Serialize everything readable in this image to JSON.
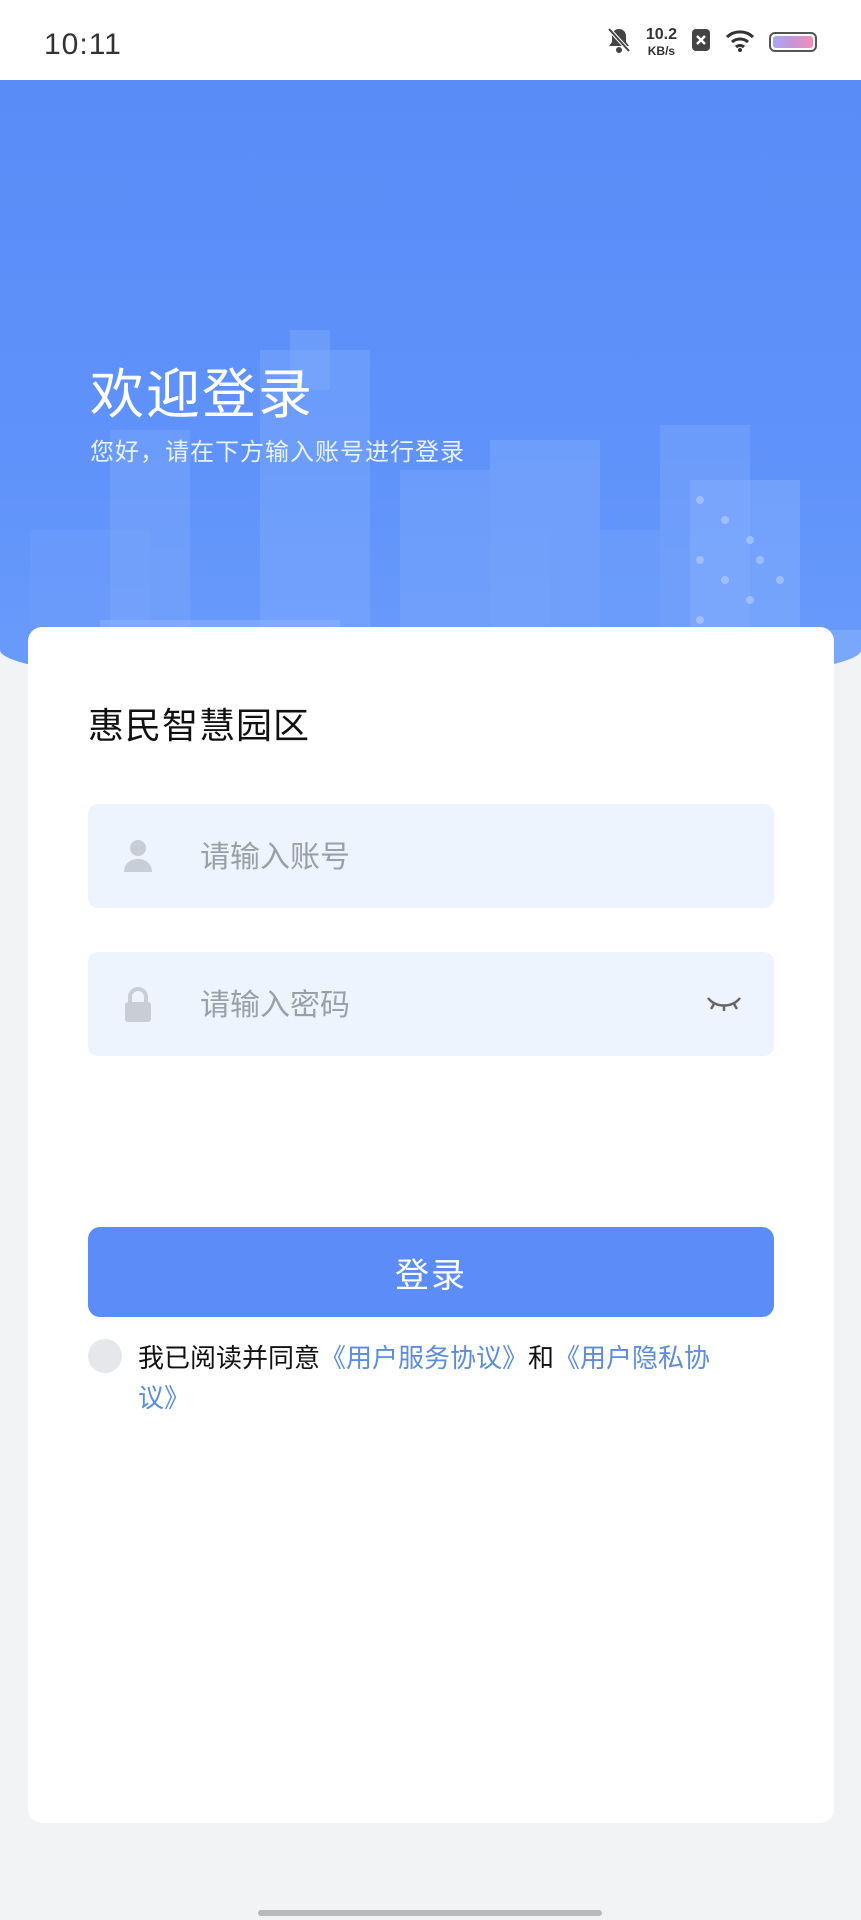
{
  "status_bar": {
    "time": "10:11",
    "net_speed_value": "10.2",
    "net_speed_unit": "KB/s",
    "icons": [
      "bell-off-icon",
      "no-sim-icon",
      "wifi-icon",
      "battery-icon"
    ]
  },
  "hero": {
    "title": "欢迎登录",
    "subtitle": "您好，请在下方输入账号进行登录"
  },
  "form": {
    "app_name": "惠民智慧园区",
    "account_placeholder": "请输入账号",
    "password_placeholder": "请输入密码",
    "login_label": "登录"
  },
  "agreement": {
    "prefix": "我已阅读并同意",
    "service_link": "《用户服务协议》",
    "and": "和",
    "privacy_link": "《用户隐私协议》",
    "checked": false
  },
  "colors": {
    "primary": "#5b8cf7",
    "link": "#5b8ce0",
    "field_bg": "#eef4fe"
  }
}
